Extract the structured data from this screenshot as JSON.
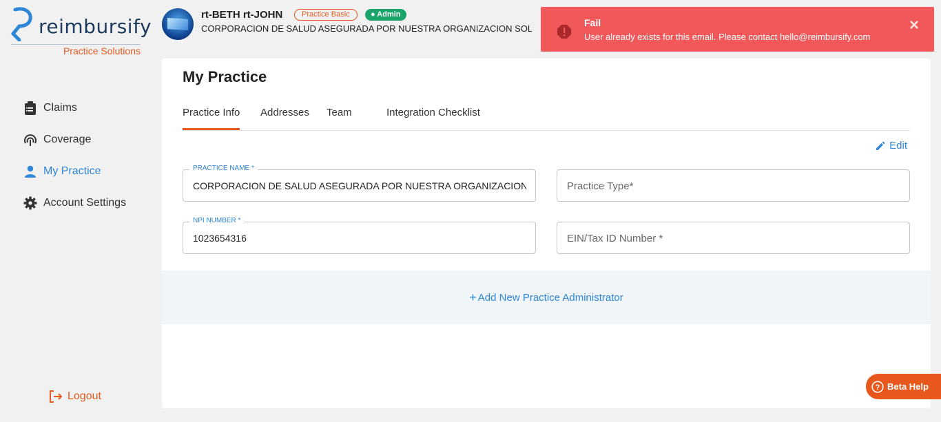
{
  "brand": {
    "name": "reimbursify",
    "subtitle": "Practice Solutions",
    "accent": "#e8581c",
    "primary": "#2e86d6"
  },
  "sidebar": {
    "items": [
      {
        "label": "Claims",
        "icon": "clipboard-icon",
        "active": false
      },
      {
        "label": "Coverage",
        "icon": "coverage-icon",
        "active": false
      },
      {
        "label": "My Practice",
        "icon": "user-icon",
        "active": true
      },
      {
        "label": "Account Settings",
        "icon": "gear-icon",
        "active": false
      }
    ],
    "logout_label": "Logout"
  },
  "header": {
    "user_name": "rt-BETH rt-JOHN",
    "plan_badge": "Practice Basic",
    "role_badge": "Admin",
    "org_name": "CORPORACION DE SALUD ASEGURADA POR NUESTRA ORGANIZACION SOLIDARIA"
  },
  "toast": {
    "title": "Fail",
    "message": "User already exists for this email. Please contact hello@reimbursify.com",
    "color": "#f0585a"
  },
  "main": {
    "title": "My Practice",
    "tabs": [
      {
        "label": "Practice Info",
        "active": true
      },
      {
        "label": "Addresses",
        "active": false
      },
      {
        "label": "Team",
        "active": false
      },
      {
        "label": "Integration Checklist",
        "active": false
      }
    ],
    "edit_label": "Edit",
    "fields": {
      "practice_name": {
        "label": "PRACTICE NAME *",
        "value": "CORPORACION DE SALUD ASEGURADA POR NUESTRA ORGANIZACION SOLIDARIA"
      },
      "practice_type": {
        "placeholder": "Practice Type*"
      },
      "npi_number": {
        "label": "NPI NUMBER *",
        "value": "1023654316"
      },
      "ein": {
        "placeholder": "EIN/Tax ID Number *"
      }
    },
    "add_admin_label": "Add New Practice Administrator"
  },
  "beta_help": {
    "label": "Beta Help"
  }
}
